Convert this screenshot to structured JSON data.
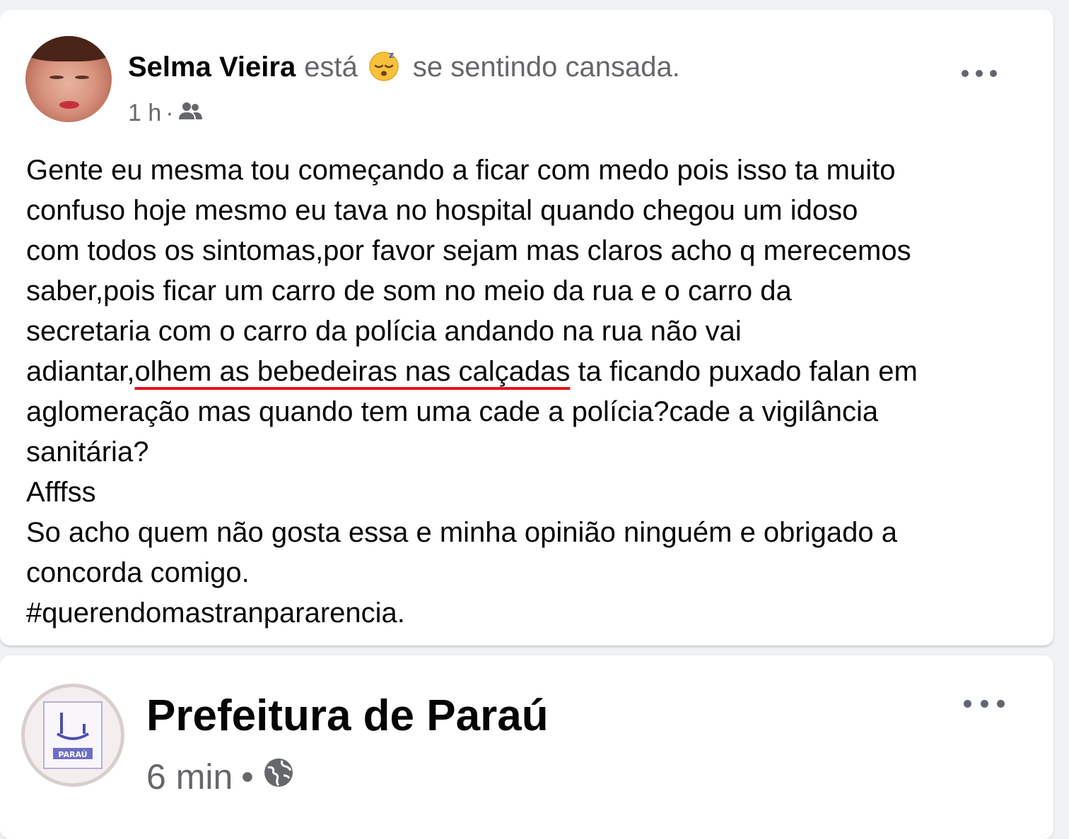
{
  "post1": {
    "author": "Selma Vieira",
    "feeling_verb": "está",
    "feeling_emoji": "sleepy-face-emoji",
    "feeling_text": "se sentindo cansada.",
    "time": "1 h",
    "separator": "·",
    "audience_icon": "friends-icon",
    "body_lines": [
      "Gente eu mesma tou começando a ficar com medo pois   isso ta muito",
      "confuso hoje mesmo eu tava no hospital quando chegou um idoso",
      "com todos os sintomas,por favor sejam mas claros acho q merecemos",
      "saber,pois ficar um carro de som no meio da rua e o carro da",
      "secretaria com o carro da polícia andando na rua não vai"
    ],
    "line6_before": "adiantar,",
    "line6_underlined": "olhem as bebedeiras nas calçadas",
    "line6_after": " ta ficando puxado falan em",
    "body_lines_2": [
      "aglomeração mas quando tem uma cade a polícia?cade a vigilância",
      "sanitária?",
      "Afffss",
      "So acho quem não gosta essa e minha opinião ninguém e obrigado a",
      "concorda comigo."
    ],
    "hashtag": "#querendomastranpararencia."
  },
  "post2": {
    "page_name": "Prefeitura de Paraú",
    "time": "6 min",
    "separator": "•",
    "audience_icon": "globe-icon",
    "avatar_text": "PARAÚ"
  },
  "colors": {
    "underline": "#e5121d",
    "meta_text": "#65676b",
    "main_text": "#050505",
    "background": "#f0f2f5"
  }
}
